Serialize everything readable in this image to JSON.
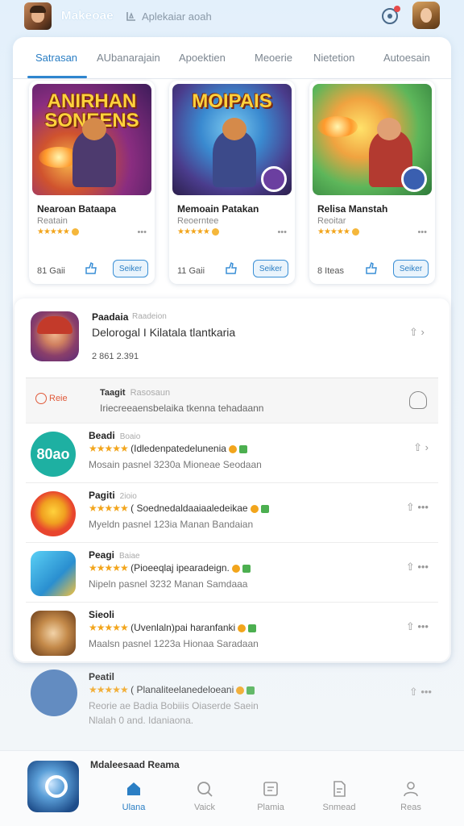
{
  "header": {
    "app_title": "Makeoae",
    "search_placeholder": "Aplekaiar aoah"
  },
  "tabs": [
    {
      "label": "Satrasan",
      "active": true
    },
    {
      "label": "AUbanarajain",
      "active": false
    },
    {
      "label": "Apoektien",
      "active": false
    },
    {
      "label": "Meoerie",
      "active": false
    },
    {
      "label": "Nietetion",
      "active": false
    },
    {
      "label": "Autoesain",
      "active": false
    }
  ],
  "featured": [
    {
      "art_title": "ANIRHAN SONEENS",
      "name": "Nearoan Bataapa",
      "sub": "Reatain",
      "stars": "★★★★★",
      "size": "81 Gaii",
      "button": "Seiker"
    },
    {
      "art_title": "MOIPAIS",
      "name": "Memoain Patakan",
      "sub": "Reoerntee",
      "stars": "★★★★★",
      "size": "11 Gaii",
      "button": "Seiker"
    },
    {
      "art_title": "",
      "name": "Relisa Manstah",
      "sub": "Reoitar",
      "stars": "★★★★★",
      "size": "8 Iteas",
      "button": "Seiker"
    }
  ],
  "hero": {
    "name": "Paadaia",
    "tag": "Raadeion",
    "description": "Delorogal I Kilatala tlantkaria",
    "meta": "2 861   2.391"
  },
  "promo": {
    "badge": "Reie",
    "title": "Taagit",
    "subtitle": "Rasosaun",
    "description": "Iriecreeaensbelaika tkenna tehadaann"
  },
  "apps": [
    {
      "name": "Beadi",
      "tag": "Boaio",
      "rating_text": "(Idledenpatedelunenia",
      "desc": "Mosain pasnel 3230a Mioneae Seodaan",
      "icon_text": "80ao",
      "icon_color": "#1eb0a2"
    },
    {
      "name": "Pagiti",
      "tag": "2ioio",
      "rating_text": "( Soednedaldaaiaaledeikae",
      "desc": "Myeldn pasnel 123ia Manan Bandaian",
      "icon_text": "",
      "icon_color": "#e8452e"
    },
    {
      "name": "Peagi",
      "tag": "Baiae",
      "rating_text": "(Pioeeqlaj ipearadeign.",
      "desc": "Nipeln pasnel 3232 Manan Samdaaa",
      "icon_text": "",
      "icon_color": "#3aa6e0"
    },
    {
      "name": "Sieoli",
      "tag": "",
      "rating_text": "(Uvenlaln)pai haranfanki",
      "desc": "Maalsn pasnel 1223a Hionaa Saradaan",
      "icon_text": "",
      "icon_color": "#c48a4a"
    }
  ],
  "faded_app": {
    "name": "Peatil",
    "rating_text": "( Planaliteelanedeloeani",
    "desc": "Reorie ae Badia Bobiiis Oiaserde Saein",
    "desc2": "Nlalah 0 and. Idaniaona.",
    "icon_color": "#4b7ab8"
  },
  "bottom": {
    "caption": "Mdaleesaad Reama",
    "nav": [
      {
        "label": "Ulana",
        "icon": "home-icon",
        "active": true
      },
      {
        "label": "Vaick",
        "icon": "search-icon",
        "active": false
      },
      {
        "label": "Plamia",
        "icon": "list-icon",
        "active": false
      },
      {
        "label": "Snmead",
        "icon": "document-icon",
        "active": false
      },
      {
        "label": "Reas",
        "icon": "user-icon",
        "active": false
      }
    ]
  },
  "colors": {
    "accent": "#2a7ec4",
    "star": "#f2a51c",
    "alert": "#e05a3a"
  }
}
